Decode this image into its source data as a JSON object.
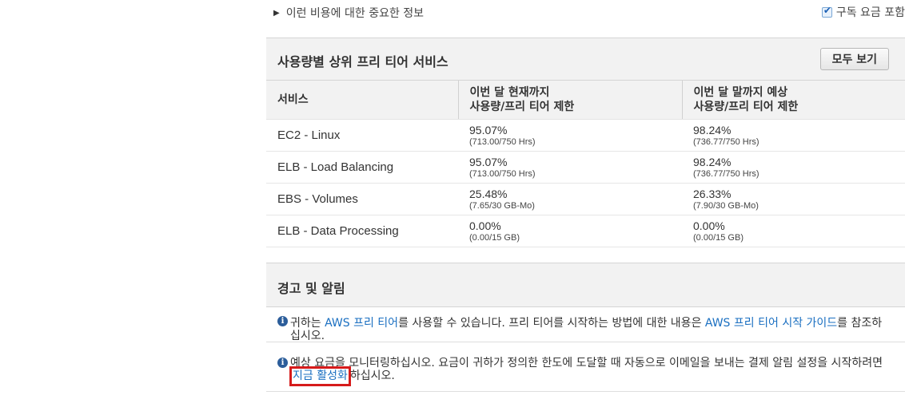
{
  "top": {
    "expander_label": "이런 비용에 대한 중요한 정보",
    "subscription_checkbox_label": "구독 요금 포함",
    "subscription_checked": true
  },
  "free_tier": {
    "title": "사용량별 상위 프리 티어 서비스",
    "view_all_label": "모두 보기",
    "columns": {
      "service": "서비스",
      "current_line1": "이번 달 현재까지",
      "current_line2": "사용량/프리 티어 제한",
      "forecast_line1": "이번 달 말까지 예상",
      "forecast_line2": "사용량/프리 티어 제한"
    },
    "rows": [
      {
        "service": "EC2 - Linux",
        "current_pct": "95.07%",
        "current_raw": "(713.00/750 Hrs)",
        "forecast_pct": "98.24%",
        "forecast_raw": "(736.77/750 Hrs)"
      },
      {
        "service": "ELB - Load Balancing",
        "current_pct": "95.07%",
        "current_raw": "(713.00/750 Hrs)",
        "forecast_pct": "98.24%",
        "forecast_raw": "(736.77/750 Hrs)"
      },
      {
        "service": "EBS - Volumes",
        "current_pct": "25.48%",
        "current_raw": "(7.65/30 GB-Mo)",
        "forecast_pct": "26.33%",
        "forecast_raw": "(7.90/30 GB-Mo)"
      },
      {
        "service": "ELB - Data Processing",
        "current_pct": "0.00%",
        "current_raw": "(0.00/15 GB)",
        "forecast_pct": "0.00%",
        "forecast_raw": "(0.00/15 GB)"
      }
    ]
  },
  "alerts": {
    "title": "경고 및 알림",
    "alert1": {
      "t1": "귀하는 ",
      "link1": "AWS 프리 티어",
      "t2": "를 사용할 수 있습니다. 프리 티어를 시작하는 방법에 대한 내용은 ",
      "link2": "AWS 프리 티어 시작 가이드",
      "t3": "를 참조하십시오."
    },
    "alert2": {
      "t1": "예상 요금을 모니터링하십시오. 요금이 귀하가 정의한 한도에 도달할 때 자동으로 이메일을 보내는 결제 알림 설정을 시작하려면 ",
      "link": "지금 활성화",
      "t2": "하십시오."
    }
  },
  "colors": {
    "link": "#1a6fc1",
    "highlight_box": "#d61b1b",
    "info_icon": "#2b5d9a",
    "header_bg": "#f2f2f2"
  },
  "icons": {
    "expander": "triangle-right-icon",
    "info": "info-circle-icon",
    "checkbox": "checkmark-icon"
  }
}
